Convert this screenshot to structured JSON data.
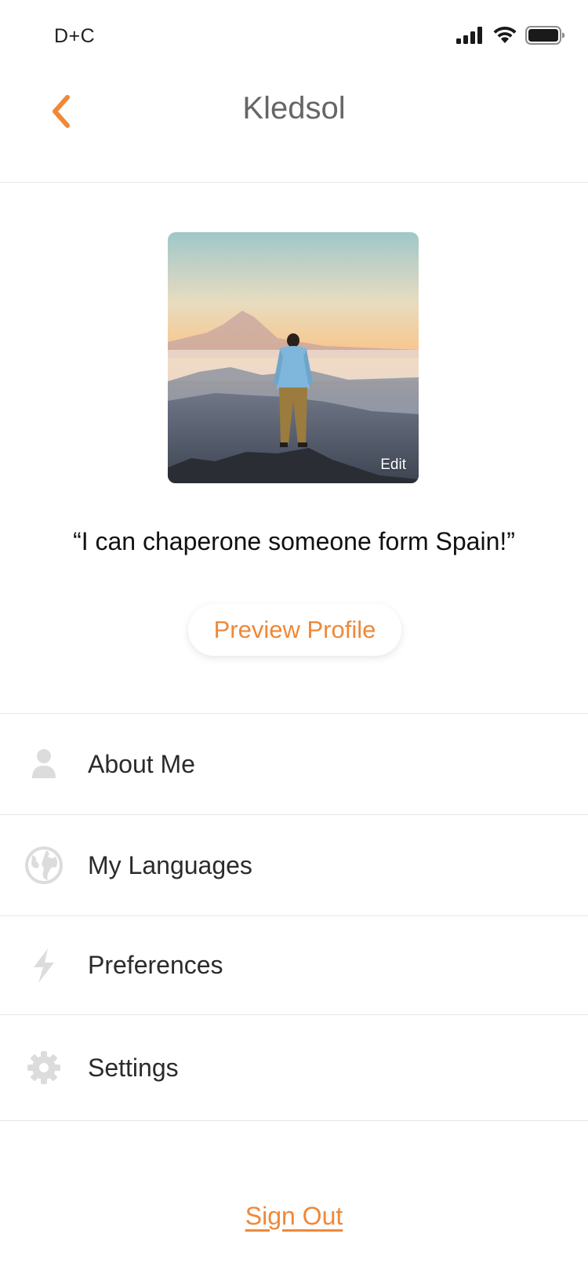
{
  "status_bar": {
    "carrier": "D+C",
    "icons": [
      "signal-icon",
      "wifi-icon",
      "battery-icon"
    ]
  },
  "nav": {
    "back_icon": "chevron-left-icon",
    "title": "Kledsol"
  },
  "profile": {
    "photo_alt": "profile-photo",
    "edit_label": "Edit",
    "quote": "“I can chaperone someone form Spain!”",
    "preview_button_label": "Preview Profile"
  },
  "menu": {
    "items": [
      {
        "label": "About Me",
        "icon": "person-icon"
      },
      {
        "label": "My Languages",
        "icon": "globe-icon"
      },
      {
        "label": "Preferences",
        "icon": "lightning-icon"
      },
      {
        "label": "Settings",
        "icon": "gear-icon"
      }
    ]
  },
  "footer": {
    "sign_out_label": "Sign Out"
  },
  "colors": {
    "accent": "#ef8838",
    "title_gray": "#666666",
    "icon_gray": "#dcdcdc",
    "divider": "#e6e6e6"
  }
}
